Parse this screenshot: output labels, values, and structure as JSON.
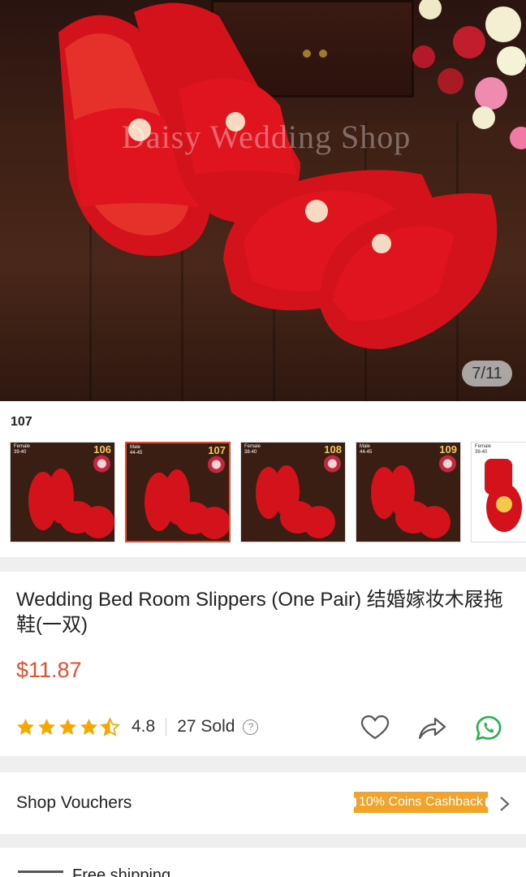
{
  "hero": {
    "watermark": "Daisy Wedding Shop",
    "counter": "7/11"
  },
  "variants": {
    "selected_label": "107",
    "items": [
      {
        "num": "106",
        "tag": "Female\n39-40"
      },
      {
        "num": "107",
        "tag": "Male\n44-45"
      },
      {
        "num": "108",
        "tag": "Female\n38-40"
      },
      {
        "num": "109",
        "tag": "Male\n44-45"
      },
      {
        "num": "",
        "tag": "Female\n39-40"
      }
    ]
  },
  "product": {
    "title": "Wedding Bed Room Slippers (One Pair) 结婚嫁妆木屐拖鞋(一双)",
    "price": "$11.87",
    "rating": "4.8",
    "rating_stars": 4.5,
    "sold": "27 Sold",
    "help_symbol": "?"
  },
  "vouchers": {
    "label": "Shop Vouchers",
    "badge": "10% Coins Cashback"
  },
  "shipping": {
    "label": "Free shipping"
  },
  "colors": {
    "accent": "#ee4d2d",
    "star": "#f6a700",
    "cashback": "#f4a32a",
    "whatsapp": "#25b244"
  }
}
